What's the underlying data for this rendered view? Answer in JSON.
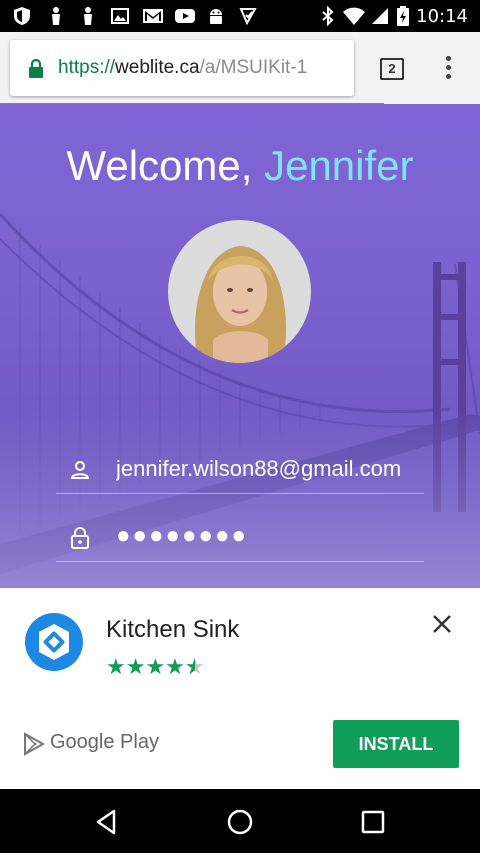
{
  "status_bar": {
    "time": "10:14",
    "left_icons": [
      "shield-icon",
      "notification-icon",
      "notification-icon",
      "image-icon",
      "gmail-icon",
      "youtube-icon",
      "android-icon",
      "download-icon"
    ],
    "right_icons": [
      "bluetooth-icon",
      "wifi-icon",
      "signal-icon",
      "battery-icon"
    ]
  },
  "browser": {
    "url_scheme": "https://",
    "url_host": "weblite.ca",
    "url_path": "/a/MSUIKit-1",
    "tab_count": "2",
    "load_progress": 0.8,
    "secure_color": "#0b8043"
  },
  "login": {
    "welcome_prefix": "Welcome, ",
    "user_name": "Jennifer",
    "name_color": "#7fe3ff",
    "email": "jennifer.wilson88@gmail.com",
    "password_mask": "●●●●●●●●"
  },
  "ad": {
    "app_title": "Kitchen Sink",
    "rating": 4.5,
    "stars": "★★★★",
    "half_star": "★",
    "store_label": "Google Play",
    "install_label": "INSTALL",
    "accent": "#0f9d58"
  },
  "nav": {
    "buttons": [
      "back-icon",
      "home-icon",
      "recents-icon"
    ]
  }
}
